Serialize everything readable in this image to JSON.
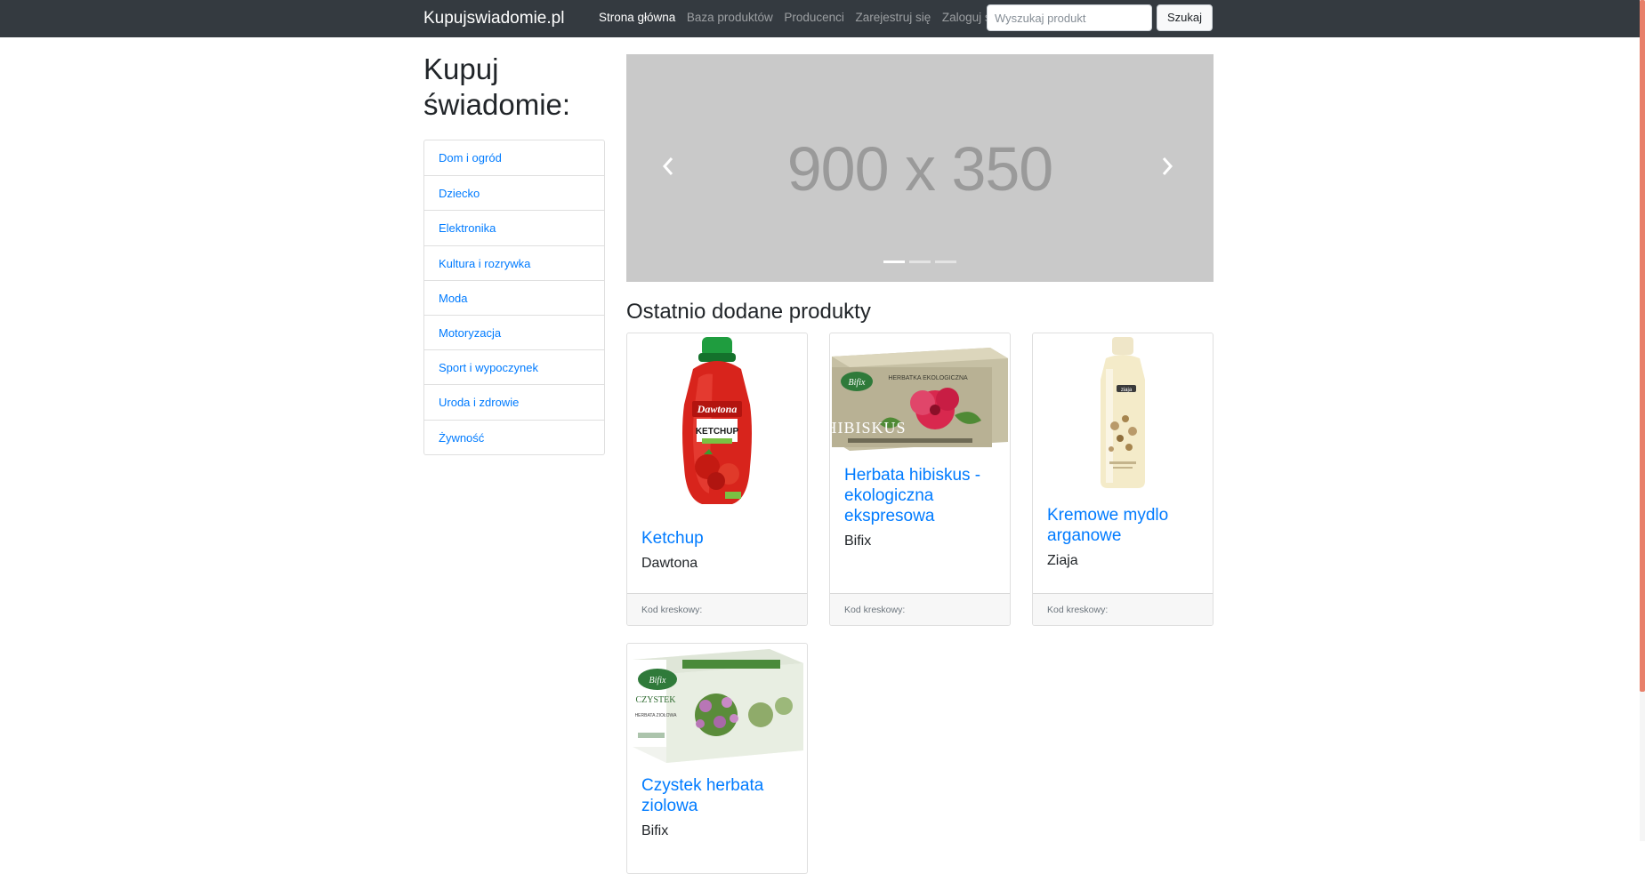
{
  "navbar": {
    "brand": "Kupujswiadomie.pl",
    "links": [
      "Strona główna",
      "Baza produktów",
      "Producenci",
      "Zarejestruj się",
      "Zaloguj się"
    ],
    "search_placeholder": "Wyszukaj produkt",
    "search_button": "Szukaj"
  },
  "sidebar": {
    "title": "Kupuj świadomie:",
    "categories": [
      "Dom i ogród",
      "Dziecko",
      "Elektronika",
      "Kultura i rozrywka",
      "Moda",
      "Motoryzacja",
      "Sport i wypoczynek",
      "Uroda i zdrowie",
      "Żywność"
    ]
  },
  "carousel": {
    "placeholder_text": "900 x 350",
    "prev_icon": "chevron-left-icon",
    "next_icon": "chevron-right-icon",
    "slide_count": 3,
    "active_slide": 1
  },
  "main": {
    "section_title": "Ostatnio dodane produkty",
    "products": [
      {
        "name": "Ketchup",
        "brand": "Dawtona",
        "barcode_label": "Kod kreskowy:"
      },
      {
        "name": "Herbata hibiskus - ekologiczna ekspresowa",
        "brand": "Bifix",
        "barcode_label": "Kod kreskowy:"
      },
      {
        "name": "Kremowe mydlo arganowe",
        "brand": "Ziaja",
        "barcode_label": "Kod kreskowy:"
      },
      {
        "name": "Czystek herbata ziolowa",
        "brand": "Bifix",
        "barcode_label": "Kod kreskowy:"
      }
    ],
    "image_text": {
      "ketchup_brand": "Dawtona",
      "ketchup_label": "KETCHUP",
      "hibiskus_brand": "Bifix",
      "hibiskus_label": "HIBISKUS",
      "hibiskus_sub": "HERBATKA EKOLOGICZNA",
      "soap_brand": "ziaja",
      "czystek_brand": "Bifix",
      "czystek_label": "CZYSTEK",
      "czystek_sub": "HERBATA ZIOŁOWA"
    }
  },
  "colors": {
    "navbar_bg": "#343a40",
    "link": "#007bff",
    "carousel_bg": "#c9c9c9",
    "scrollbar_thumb": "#e8806a"
  }
}
